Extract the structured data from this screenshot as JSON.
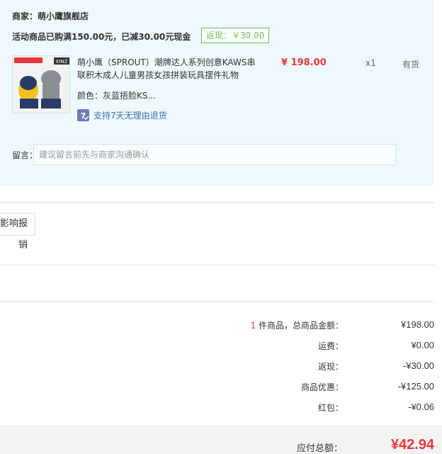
{
  "shop": {
    "name": "商家：萌小鹰旗舰店",
    "promo": "活动商品已购满150.00元，已减30.00元现金",
    "rebate_badge": "返现：￥30.00"
  },
  "product": {
    "title": "萌小鹰（SPROUT）潮牌达人系列创意KAWS串联积木成人儿童男孩女孩拼装玩具摆件礼物",
    "price": "¥ 198.00",
    "qty": "x1",
    "stock": "有货",
    "color": "颜色：灰蓝捂脸KS...",
    "return_policy": "支持7天无理由退货",
    "thumb_brand": "XINZ"
  },
  "message": {
    "label": "留言：",
    "placeholder": "建议留言前先与商家沟通确认"
  },
  "report_button": "影响报销",
  "summary": {
    "count": "1",
    "items_label": "件商品，总商品金额：",
    "items_value": "¥198.00",
    "shipping_label": "运费：",
    "shipping_value": "¥0.00",
    "rebate_label": "返现：",
    "rebate_value": "-¥30.00",
    "discount_label": "商品优惠：",
    "discount_value": "-¥125.00",
    "redpacket_label": "红包：",
    "redpacket_value": "-¥0.06",
    "total_label": "应付总额：",
    "total_value": "¥42.94"
  },
  "colors": {
    "accent_red": "#e4393c",
    "rebate_green": "#6cbf5a",
    "panel_bg": "#eef8fd",
    "link_blue": "#3a6fb0"
  }
}
